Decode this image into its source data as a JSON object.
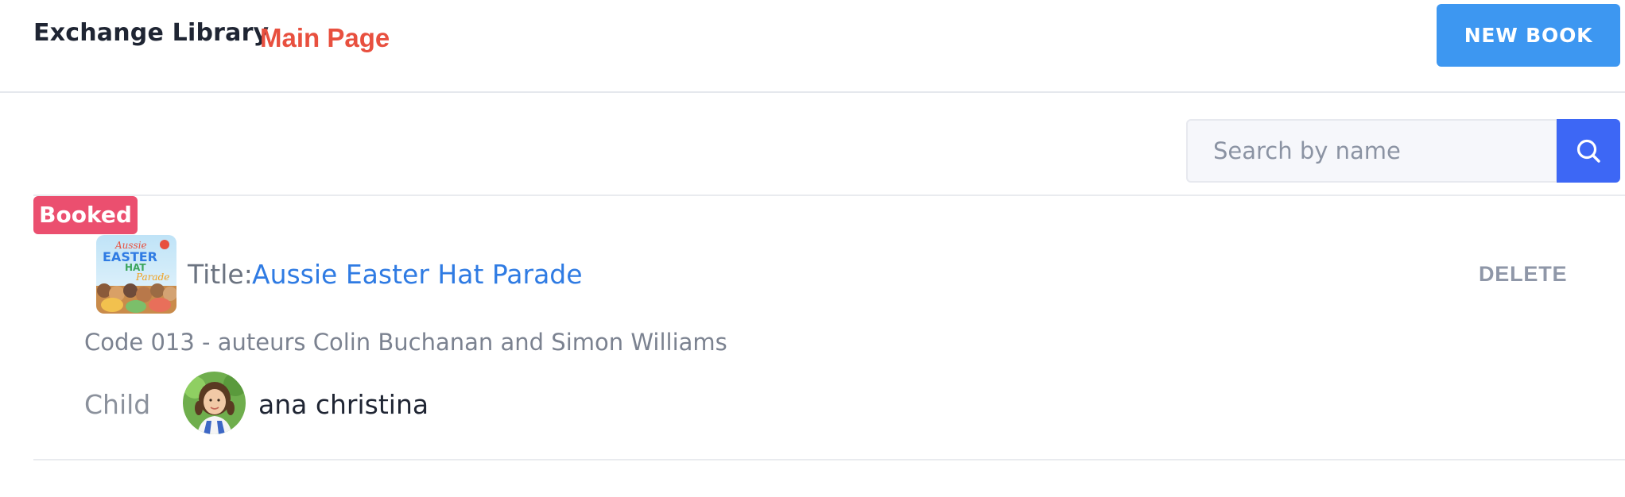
{
  "header": {
    "brand": "Exchange Library",
    "main_link": "Main Page",
    "new_book_label": "NEW BOOK"
  },
  "search": {
    "placeholder": "Search by name",
    "value": "",
    "icon": "search-icon"
  },
  "bookings": [
    {
      "status": "Booked",
      "title_label": "Title:",
      "title": "Aussie Easter Hat Parade",
      "cover_lettering": [
        "Aussie",
        "EASTER",
        "HAT",
        "Parade"
      ],
      "delete_label": "DELETE",
      "code_line": "Code 013 - auteurs Colin Buchanan and Simon Williams",
      "child_label": "Child",
      "child_name": "ana christina"
    }
  ],
  "colors": {
    "accent_blue": "#3d97f1",
    "search_button": "#3d67f5",
    "main_link_red": "#e8503f",
    "booked_badge": "#eb4f6f",
    "title_link": "#2f7be3"
  }
}
